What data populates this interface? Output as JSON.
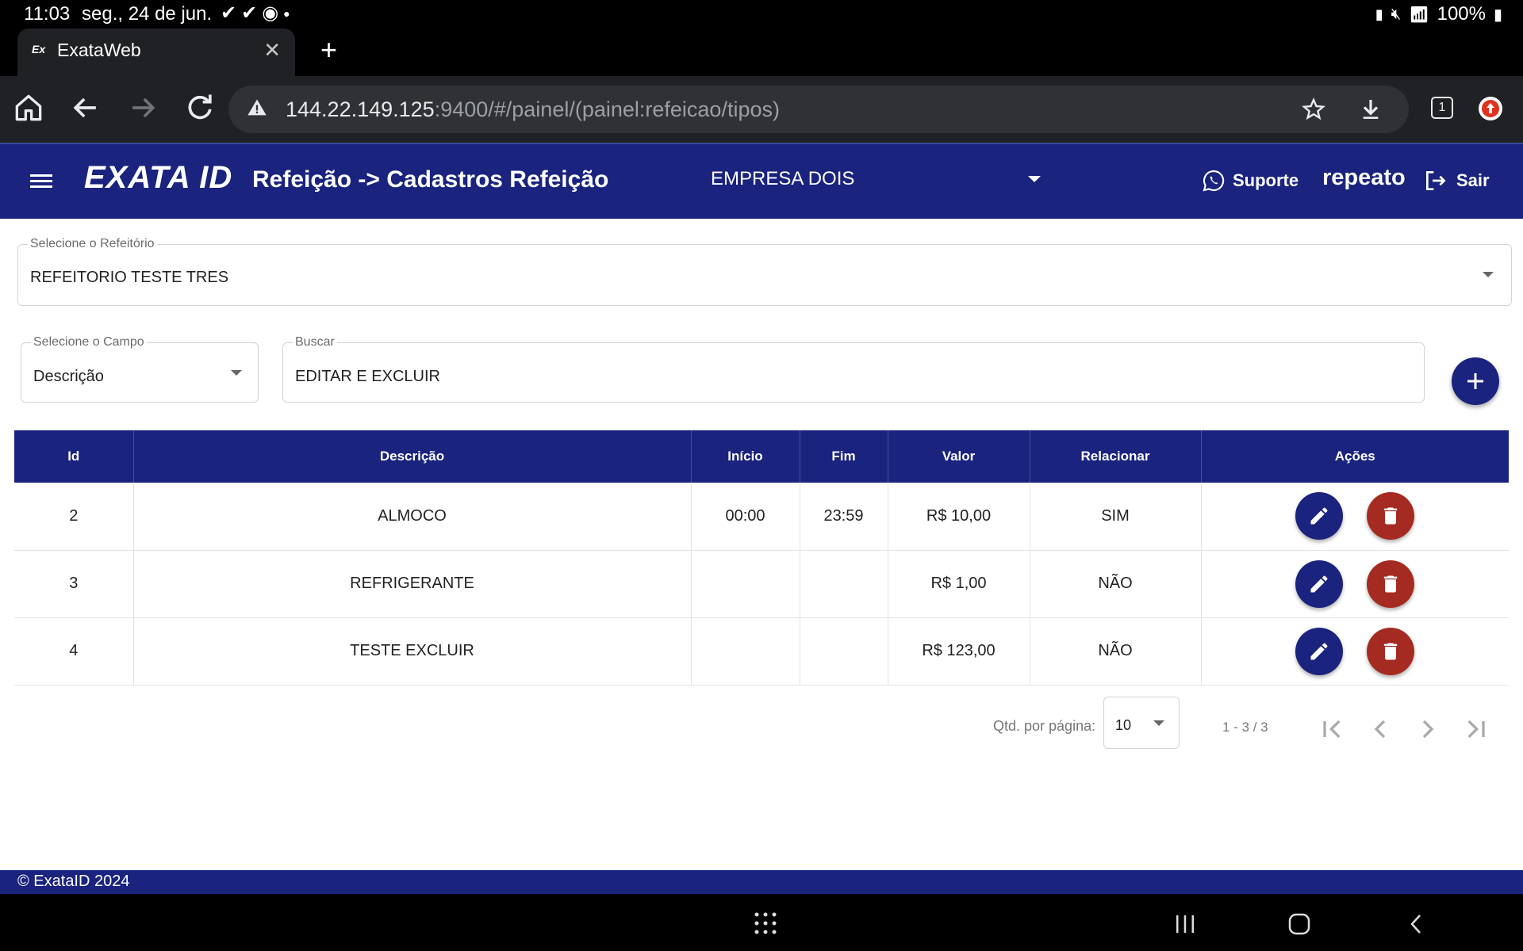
{
  "status_bar": {
    "time": "11:03",
    "date": "seg., 24 de jun.",
    "battery": "100%"
  },
  "browser": {
    "tab_title": "ExataWeb",
    "favicon_text": "Ex",
    "url_host": "144.22.149.125",
    "url_rest": ":9400/#/painel/(painel:refeicao/tipos)",
    "tab_count": "1"
  },
  "header": {
    "logo": "EXATA ID",
    "page_title": "Refeição -> Cadastros Refeição",
    "company": "EMPRESA DOIS",
    "support_label": "Suporte",
    "username": "repeato",
    "logout_label": "Sair"
  },
  "filters": {
    "refeitorio_label": "Selecione o Refeitório",
    "refeitorio_value": "REFEITORIO TESTE TRES",
    "campo_label": "Selecione o Campo",
    "campo_value": "Descrição",
    "search_label": "Buscar",
    "search_value": "EDITAR E EXCLUIR"
  },
  "table": {
    "headers": [
      "Id",
      "Descrição",
      "Início",
      "Fim",
      "Valor",
      "Relacionar",
      "Ações"
    ],
    "rows": [
      {
        "id": "2",
        "descricao": "ALMOCO",
        "inicio": "00:00",
        "fim": "23:59",
        "valor": "R$ 10,00",
        "relacionar": "SIM"
      },
      {
        "id": "3",
        "descricao": "REFRIGERANTE",
        "inicio": "",
        "fim": "",
        "valor": "R$ 1,00",
        "relacionar": "NÃO"
      },
      {
        "id": "4",
        "descricao": "TESTE EXCLUIR",
        "inicio": "",
        "fim": "",
        "valor": "R$ 123,00",
        "relacionar": "NÃO"
      }
    ]
  },
  "paginator": {
    "page_size_label": "Qtd. por página:",
    "page_size": "10",
    "range": "1 - 3 / 3"
  },
  "footer": {
    "copyright": "© ExataID 2024"
  },
  "colors": {
    "primary": "#1a237e",
    "danger": "#a52b22"
  }
}
